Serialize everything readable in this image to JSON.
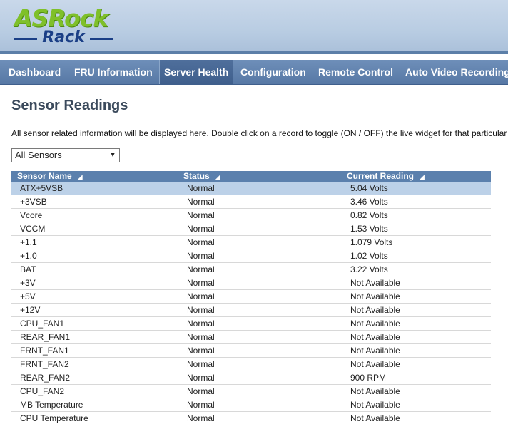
{
  "header": {
    "logo_top": "ASRock",
    "logo_bottom": "Rack"
  },
  "nav": {
    "items": [
      {
        "label": "Dashboard",
        "active": false
      },
      {
        "label": "FRU Information",
        "active": false
      },
      {
        "label": "Server Health",
        "active": true
      },
      {
        "label": "Configuration",
        "active": false
      },
      {
        "label": "Remote Control",
        "active": false
      },
      {
        "label": "Auto Video Recording",
        "active": false
      }
    ]
  },
  "main": {
    "title": "Sensor Readings",
    "description": "All sensor related information will be displayed here. Double click on a record to toggle (ON / OFF) the live widget for that particular",
    "filter": {
      "selected": "All Sensors"
    },
    "table": {
      "columns": [
        "Sensor Name",
        "Status",
        "Current Reading"
      ],
      "rows": [
        {
          "name": "ATX+5VSB",
          "status": "Normal",
          "reading": "5.04 Volts"
        },
        {
          "name": "+3VSB",
          "status": "Normal",
          "reading": "3.46 Volts"
        },
        {
          "name": "Vcore",
          "status": "Normal",
          "reading": "0.82 Volts"
        },
        {
          "name": "VCCM",
          "status": "Normal",
          "reading": "1.53 Volts"
        },
        {
          "name": "+1.1",
          "status": "Normal",
          "reading": "1.079 Volts"
        },
        {
          "name": "+1.0",
          "status": "Normal",
          "reading": "1.02 Volts"
        },
        {
          "name": "BAT",
          "status": "Normal",
          "reading": "3.22 Volts"
        },
        {
          "name": "+3V",
          "status": "Normal",
          "reading": "Not Available"
        },
        {
          "name": "+5V",
          "status": "Normal",
          "reading": "Not Available"
        },
        {
          "name": "+12V",
          "status": "Normal",
          "reading": "Not Available"
        },
        {
          "name": "CPU_FAN1",
          "status": "Normal",
          "reading": "Not Available"
        },
        {
          "name": "REAR_FAN1",
          "status": "Normal",
          "reading": "Not Available"
        },
        {
          "name": "FRNT_FAN1",
          "status": "Normal",
          "reading": "Not Available"
        },
        {
          "name": "FRNT_FAN2",
          "status": "Normal",
          "reading": "Not Available"
        },
        {
          "name": "REAR_FAN2",
          "status": "Normal",
          "reading": "900 RPM"
        },
        {
          "name": "CPU_FAN2",
          "status": "Normal",
          "reading": "Not Available"
        },
        {
          "name": "MB Temperature",
          "status": "Normal",
          "reading": "Not Available"
        },
        {
          "name": "CPU Temperature",
          "status": "Normal",
          "reading": "Not Available"
        }
      ]
    }
  },
  "colors": {
    "nav_bg": "#5778a5",
    "table_header": "#5b80ad",
    "selected_row": "#bcd1e8",
    "logo_green": "#7fc02a",
    "logo_blue": "#1b3f86"
  }
}
